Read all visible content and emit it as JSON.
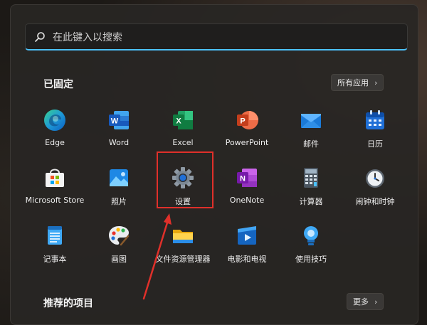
{
  "search": {
    "placeholder": "在此键入以搜索"
  },
  "pinned": {
    "title": "已固定",
    "all_apps_label": "所有应用",
    "apps": [
      {
        "label": "Edge",
        "icon": "edge-icon"
      },
      {
        "label": "Word",
        "icon": "word-icon"
      },
      {
        "label": "Excel",
        "icon": "excel-icon"
      },
      {
        "label": "PowerPoint",
        "icon": "powerpoint-icon"
      },
      {
        "label": "邮件",
        "icon": "mail-icon"
      },
      {
        "label": "日历",
        "icon": "calendar-icon"
      },
      {
        "label": "Microsoft Store",
        "icon": "store-icon"
      },
      {
        "label": "照片",
        "icon": "photos-icon"
      },
      {
        "label": "设置",
        "icon": "settings-gear-icon"
      },
      {
        "label": "OneNote",
        "icon": "onenote-icon"
      },
      {
        "label": "计算器",
        "icon": "calculator-icon"
      },
      {
        "label": "闹钟和时钟",
        "icon": "clock-icon"
      },
      {
        "label": "记事本",
        "icon": "notepad-icon"
      },
      {
        "label": "画图",
        "icon": "paint-icon"
      },
      {
        "label": "文件资源管理器",
        "icon": "folder-icon"
      },
      {
        "label": "电影和电视",
        "icon": "movies-icon"
      },
      {
        "label": "使用技巧",
        "icon": "tips-icon"
      }
    ]
  },
  "recommended": {
    "title": "推荐的项目",
    "more_label": "更多"
  },
  "colors": {
    "accent": "#4cc2ff",
    "highlight": "#e0302a"
  }
}
